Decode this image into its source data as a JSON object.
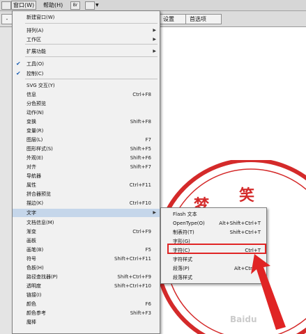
{
  "menubar": {
    "window": "窗口(W)",
    "help": "帮助(H)",
    "icon_a": "Br",
    "icon_b": "layout-icon"
  },
  "toolbar": {
    "left_btn": "-",
    "btn_a": "设置",
    "btn_b": "首选项"
  },
  "window_menu": [
    {
      "label": "新建窗口(W)",
      "shortcut": "",
      "submenu": false,
      "checked": false
    },
    {
      "label": "排列(A)",
      "shortcut": "",
      "submenu": true,
      "checked": false
    },
    {
      "label": "工作区",
      "shortcut": "",
      "submenu": true,
      "checked": false
    },
    {
      "label": "扩展功能",
      "shortcut": "",
      "submenu": true,
      "checked": false
    },
    {
      "label": "工具(O)",
      "shortcut": "",
      "submenu": false,
      "checked": true
    },
    {
      "label": "控制(C)",
      "shortcut": "",
      "submenu": false,
      "checked": true
    },
    {
      "label": "SVG 交互(Y)",
      "shortcut": "",
      "submenu": false,
      "checked": false
    },
    {
      "label": "信息",
      "shortcut": "Ctrl+F8",
      "submenu": false,
      "checked": false
    },
    {
      "label": "分色预览",
      "shortcut": "",
      "submenu": false,
      "checked": false
    },
    {
      "label": "动作(N)",
      "shortcut": "",
      "submenu": false,
      "checked": false
    },
    {
      "label": "变换",
      "shortcut": "Shift+F8",
      "submenu": false,
      "checked": false
    },
    {
      "label": "变量(R)",
      "shortcut": "",
      "submenu": false,
      "checked": false
    },
    {
      "label": "图层(L)",
      "shortcut": "F7",
      "submenu": false,
      "checked": false
    },
    {
      "label": "图形样式(S)",
      "shortcut": "Shift+F5",
      "submenu": false,
      "checked": false
    },
    {
      "label": "外观(E)",
      "shortcut": "Shift+F6",
      "submenu": false,
      "checked": false
    },
    {
      "label": "对齐",
      "shortcut": "Shift+F7",
      "submenu": false,
      "checked": false
    },
    {
      "label": "导航器",
      "shortcut": "",
      "submenu": false,
      "checked": false
    },
    {
      "label": "属性",
      "shortcut": "Ctrl+F11",
      "submenu": false,
      "checked": false
    },
    {
      "label": "拼合器预览",
      "shortcut": "",
      "submenu": false,
      "checked": false
    },
    {
      "label": "描边(K)",
      "shortcut": "Ctrl+F10",
      "submenu": false,
      "checked": false
    },
    {
      "label": "文字",
      "shortcut": "",
      "submenu": true,
      "checked": false
    },
    {
      "label": "文档信息(M)",
      "shortcut": "",
      "submenu": false,
      "checked": false
    },
    {
      "label": "渐变",
      "shortcut": "Ctrl+F9",
      "submenu": false,
      "checked": false
    },
    {
      "label": "画板",
      "shortcut": "",
      "submenu": false,
      "checked": false
    },
    {
      "label": "画笔(B)",
      "shortcut": "F5",
      "submenu": false,
      "checked": false
    },
    {
      "label": "符号",
      "shortcut": "Shift+Ctrl+F11",
      "submenu": false,
      "checked": false
    },
    {
      "label": "色板(H)",
      "shortcut": "",
      "submenu": false,
      "checked": false
    },
    {
      "label": "路径查找器(P)",
      "shortcut": "Shift+Ctrl+F9",
      "submenu": false,
      "checked": false
    },
    {
      "label": "透明度",
      "shortcut": "Shift+Ctrl+F10",
      "submenu": false,
      "checked": false
    },
    {
      "label": "链接(I)",
      "shortcut": "",
      "submenu": false,
      "checked": false
    },
    {
      "label": "颜色",
      "shortcut": "F6",
      "submenu": false,
      "checked": false
    },
    {
      "label": "颜色参考",
      "shortcut": "Shift+F3",
      "submenu": false,
      "checked": false
    },
    {
      "label": "魔棒",
      "shortcut": "",
      "submenu": false,
      "checked": false
    }
  ],
  "text_submenu": [
    {
      "label": "Flash 文本",
      "shortcut": ""
    },
    {
      "label": "OpenType(O)",
      "shortcut": "Alt+Shift+Ctrl+T"
    },
    {
      "label": "制表符(T)",
      "shortcut": "Shift+Ctrl+T"
    },
    {
      "label": "字形(G)",
      "shortcut": ""
    },
    {
      "label": "字符(C)",
      "shortcut": "Ctrl+T"
    },
    {
      "label": "字符样式",
      "shortcut": ""
    },
    {
      "label": "段落(P)",
      "shortcut": "Alt+Ctrl+T"
    },
    {
      "label": "段落样式",
      "shortcut": ""
    }
  ],
  "seal": {
    "chars": [
      "梦",
      "笑"
    ],
    "color": "#d42a2a"
  },
  "colors": {
    "highlight": "#e02424",
    "check": "#1a5fb4",
    "menu_bg": "#f1f1f1"
  }
}
